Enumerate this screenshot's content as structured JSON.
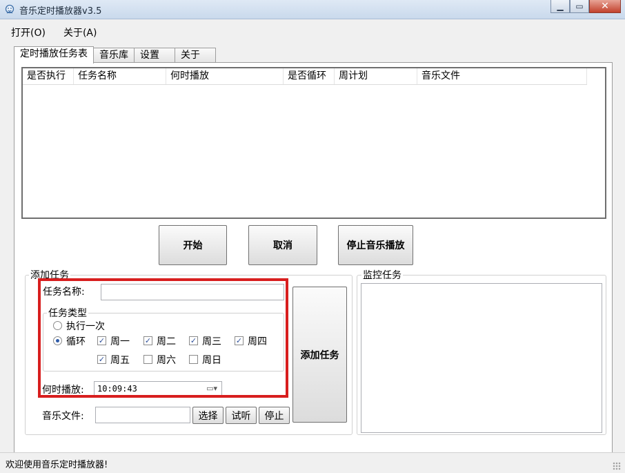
{
  "window": {
    "title": "音乐定时播放器v3.5"
  },
  "window_buttons": {
    "minimize_icon": "minimize-icon",
    "maximize_icon": "maximize-icon",
    "close_icon": "close-icon"
  },
  "menu": {
    "open": "打开(O)",
    "about": "关于(A)"
  },
  "tabs": [
    {
      "label": "定时播放任务表"
    },
    {
      "label": "音乐库"
    },
    {
      "label": "设置"
    },
    {
      "label": "关于"
    }
  ],
  "task_list": {
    "columns": [
      "是否执行",
      "任务名称",
      "何时播放",
      "是否循环",
      "周计划",
      "音乐文件"
    ]
  },
  "actions": {
    "start": "开始",
    "cancel": "取消",
    "stop_music": "停止音乐播放"
  },
  "add_task": {
    "legend": "添加任务",
    "task_name_label": "任务名称:",
    "task_name_value": "",
    "task_type_legend": "任务类型",
    "once_label": "执行一次",
    "loop_label": "循环",
    "days": [
      {
        "label": "周一",
        "checked": true
      },
      {
        "label": "周二",
        "checked": true
      },
      {
        "label": "周三",
        "checked": true
      },
      {
        "label": "周四",
        "checked": true
      },
      {
        "label": "周五",
        "checked": true
      },
      {
        "label": "周六",
        "checked": false
      },
      {
        "label": "周日",
        "checked": false
      }
    ],
    "time_label": "何时播放:",
    "time_value": "10:09:43",
    "music_file_label": "音乐文件:",
    "music_file_value": "",
    "select_btn": "选择",
    "preview_btn": "试听",
    "stop_btn": "停止",
    "add_btn": "添加任务"
  },
  "monitor": {
    "legend": "监控任务"
  },
  "status": {
    "text": "欢迎使用音乐定时播放器!"
  },
  "colors": {
    "highlight_border": "#d81e1e",
    "titlebar": "#c9d9ec",
    "close_button": "#c2412c"
  }
}
